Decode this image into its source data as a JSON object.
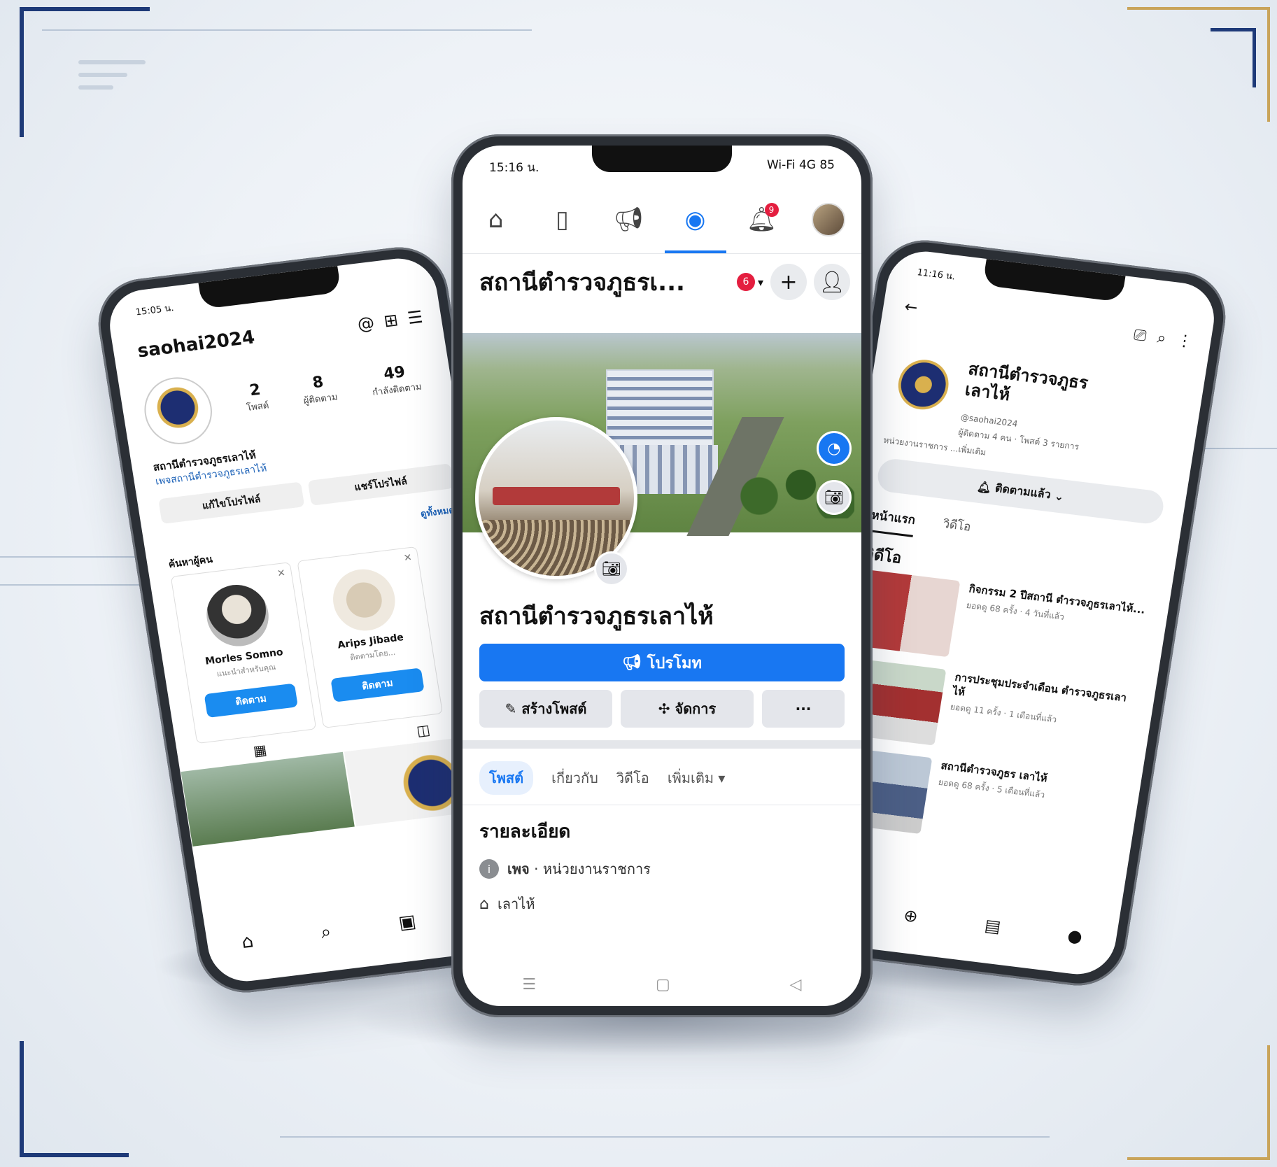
{
  "center": {
    "status_time": "15:16 น.",
    "status_right": "Wi-Fi 4G 85",
    "nav_icons": [
      "home-icon",
      "video-icon",
      "megaphone-icon",
      "profile-icon",
      "bell-icon",
      "avatar"
    ],
    "nav_badge": "9",
    "title": "สถานีตำรวจภูธรเ...",
    "title_badge": "6",
    "page_name": "สถานีตำรวจภูธรเลาไห้",
    "promote_label": "โปรโมท",
    "create_post_label": "สร้างโพสต์",
    "manage_label": "จัดการ",
    "more_label": "···",
    "tabs": [
      "โพสต์",
      "เกี่ยวกับ",
      "วิดีโอ",
      "เพิ่มเติม"
    ],
    "details_title": "รายละเอียด",
    "info_1_bold": "เพจ",
    "info_1_text": "· หน่วยงานราชการ",
    "info_2_text": "เลาไห้"
  },
  "left": {
    "status_time": "15:05 น.",
    "username": "saohai2024",
    "stats": [
      {
        "value": "2",
        "label": "โพสต์"
      },
      {
        "value": "8",
        "label": "ผู้ติดตาม"
      },
      {
        "value": "49",
        "label": "กำลังติดตาม"
      }
    ],
    "name": "สถานีตำรวจภูธรเลาไห้",
    "link": "เพจสถานีตำรวจภูธรเลาไห้",
    "edit_label": "แก้ไขโปรไฟล์",
    "share_label": "แชร์โปรไฟล์",
    "see_all": "ดูทั้งหมด",
    "suggested_title": "ค้นหาผู้คน",
    "cards": [
      {
        "name": "Morles Somno",
        "sub": "แนะนำสำหรับคุณ",
        "button": "ติดตาม"
      },
      {
        "name": "Arips Jibade",
        "sub": "ติดตามโดย...",
        "button": "ติดตาม"
      }
    ]
  },
  "right": {
    "status_time": "11:16 น.",
    "page_name_line1": "สถานีตำรวจภูธร",
    "page_name_line2": "เลาไห้",
    "sub1": "@saohai2024",
    "sub2": "ผู้ติดตาม 4 คน · โพสต์ 3 รายการ",
    "sub3": "หน่วยงานราชการ ...เพิ่มเติม",
    "follow_label": "ติดตามแล้ว",
    "tabs": [
      "หน้าแรก",
      "วิดีโอ"
    ],
    "section": "วิดีโอ",
    "videos": [
      {
        "title": "กิจกรรม 2 ปีสถานี ตำรวจภูธรเลาไห้...",
        "meta": "ยอดดู 68 ครั้ง · 4 วันที่แล้ว"
      },
      {
        "title": "การประชุมประจำเดือน ตำรวจภูธรเลาไห้",
        "meta": "ยอดดู 11 ครั้ง · 1 เดือนที่แล้ว"
      },
      {
        "title": "สถานีตำรวจภูธร เลาไห้",
        "meta": "ยอดดู 68 ครั้ง · 5 เดือนที่แล้ว"
      }
    ]
  }
}
